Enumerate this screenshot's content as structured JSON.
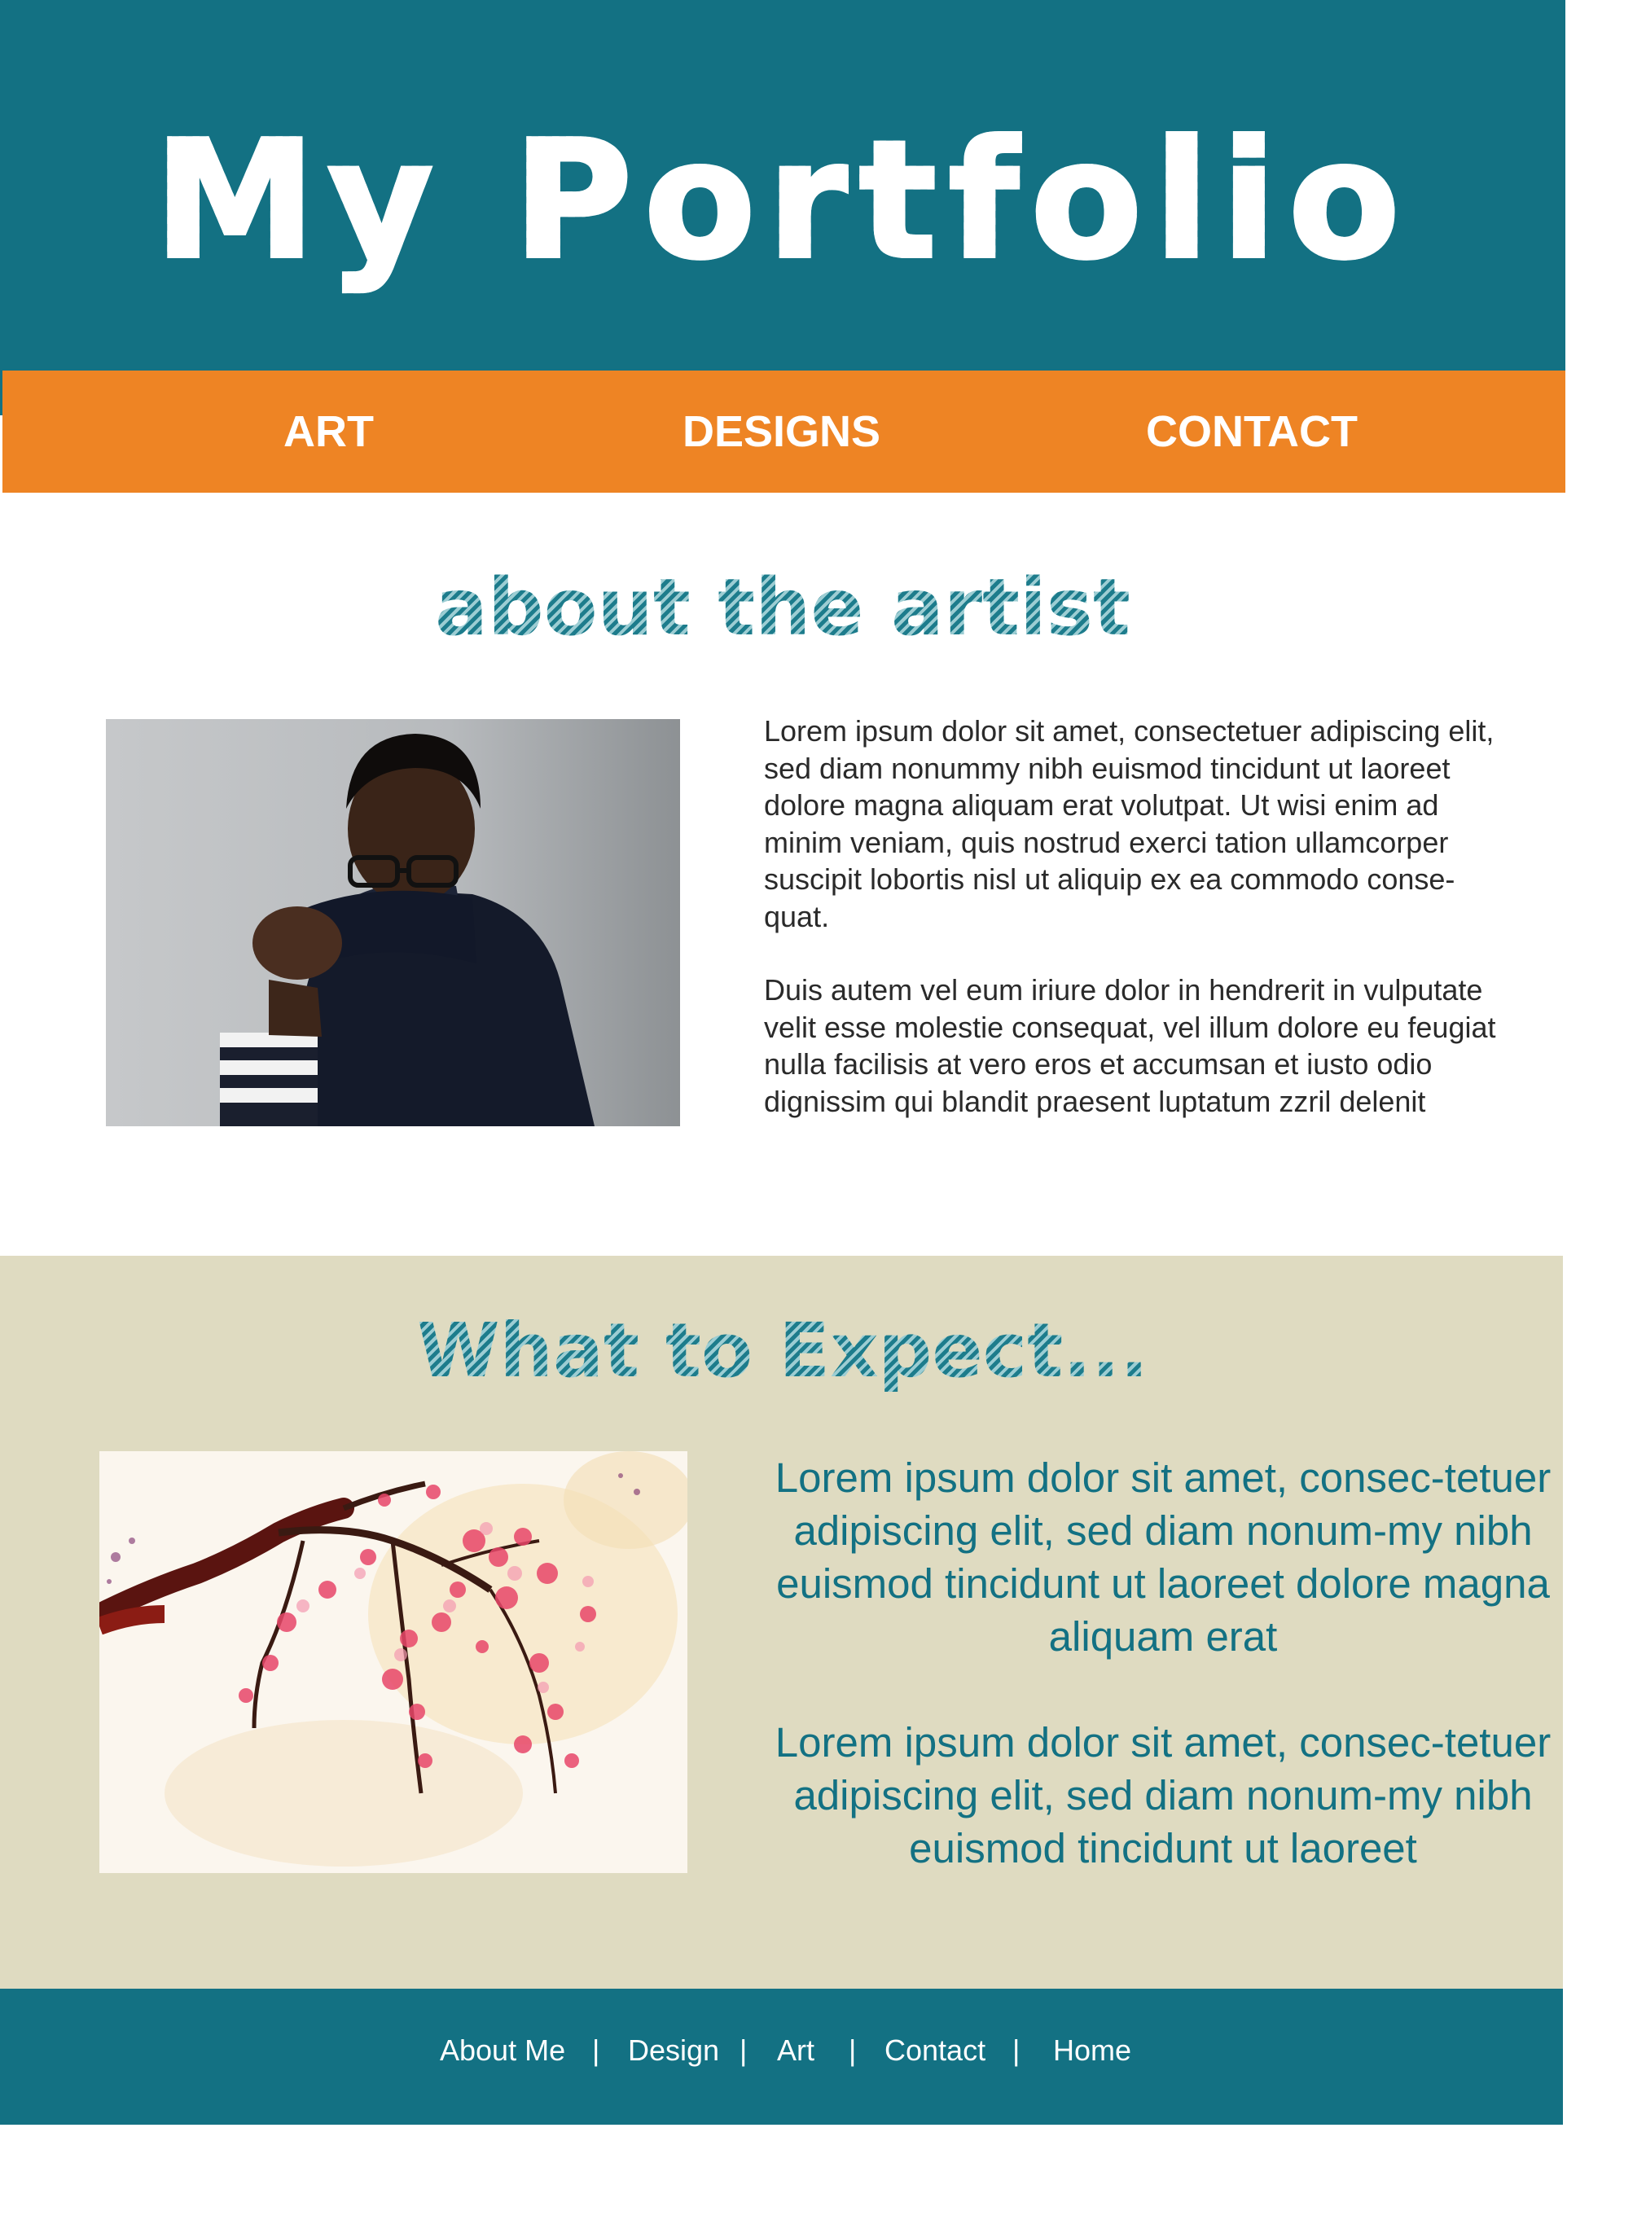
{
  "header": {
    "title": "My Portfolio",
    "background_color": "#137183"
  },
  "nav": {
    "background_color": "#ee8424",
    "items": [
      {
        "label": "ART"
      },
      {
        "label": "DESIGNS"
      },
      {
        "label": "CONTACT"
      }
    ]
  },
  "about": {
    "heading": "about the artist",
    "paragraphs": [
      "Lorem ipsum dolor sit amet, consectetuer adipiscing elit, sed diam nonummy nibh euismod tincidunt ut laoreet dolore magna aliquam erat volutpat. Ut wisi enim ad minim veniam, quis nostrud exerci tation ullamcorper suscipit lobortis nisl ut aliquip ex ea commodo conse-quat.",
      "Duis autem vel eum iriure dolor in hendrerit in vulputate velit esse molestie consequat, vel illum dolore eu feugiat nulla facilisis at vero eros et accumsan et iusto odio dignissim qui blandit praesent luptatum zzril delenit"
    ],
    "photo": "artist-portrait-image"
  },
  "expect": {
    "heading": "What to Expect...",
    "background_color": "#dfdbc1",
    "paragraphs": [
      "Lorem ipsum dolor sit amet, consec-tetuer adipiscing elit, sed diam nonum-my nibh euismod tincidunt ut laoreet dolore magna aliquam erat",
      "Lorem ipsum dolor sit amet, consec-tetuer adipiscing elit, sed diam nonum-my nibh euismod tincidunt ut laoreet"
    ],
    "image": "cherry-blossom-painting-image"
  },
  "footer": {
    "background_color": "#137183",
    "links": [
      {
        "label": "About Me"
      },
      {
        "label": "Design"
      },
      {
        "label": "Art"
      },
      {
        "label": "Contact"
      },
      {
        "label": "Home"
      }
    ],
    "separator": "|"
  }
}
